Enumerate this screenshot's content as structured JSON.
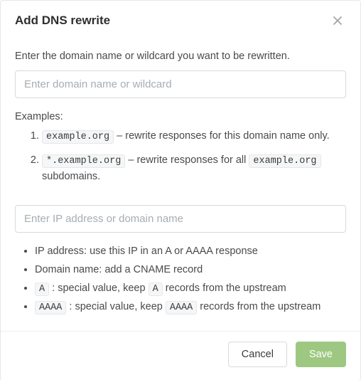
{
  "modal": {
    "title": "Add DNS rewrite",
    "lead": "Enter the domain name or wildcard you want to be rewritten.",
    "domain_input": {
      "value": "",
      "placeholder": "Enter domain name or wildcard"
    },
    "examples_label": "Examples:",
    "examples": [
      {
        "code": "example.org",
        "dash": " – ",
        "after": "rewrite responses for this domain name only."
      },
      {
        "code": "*.example.org",
        "dash": " – ",
        "mid": "rewrite responses for all ",
        "code2": "example.org",
        "after2": " subdomains."
      }
    ],
    "answer_input": {
      "value": "",
      "placeholder": "Enter IP address or domain name"
    },
    "notes": [
      {
        "text": "IP address: use this IP in an A or AAAA response"
      },
      {
        "text": "Domain name: add a CNAME record"
      },
      {
        "code": "A",
        "mid": " : special value, keep ",
        "code2": "A",
        "after": " records from the upstream"
      },
      {
        "code": "AAAA",
        "mid": " : special value, keep ",
        "code2": "AAAA",
        "after": " records from the upstream"
      }
    ],
    "buttons": {
      "cancel": "Cancel",
      "save": "Save"
    }
  }
}
